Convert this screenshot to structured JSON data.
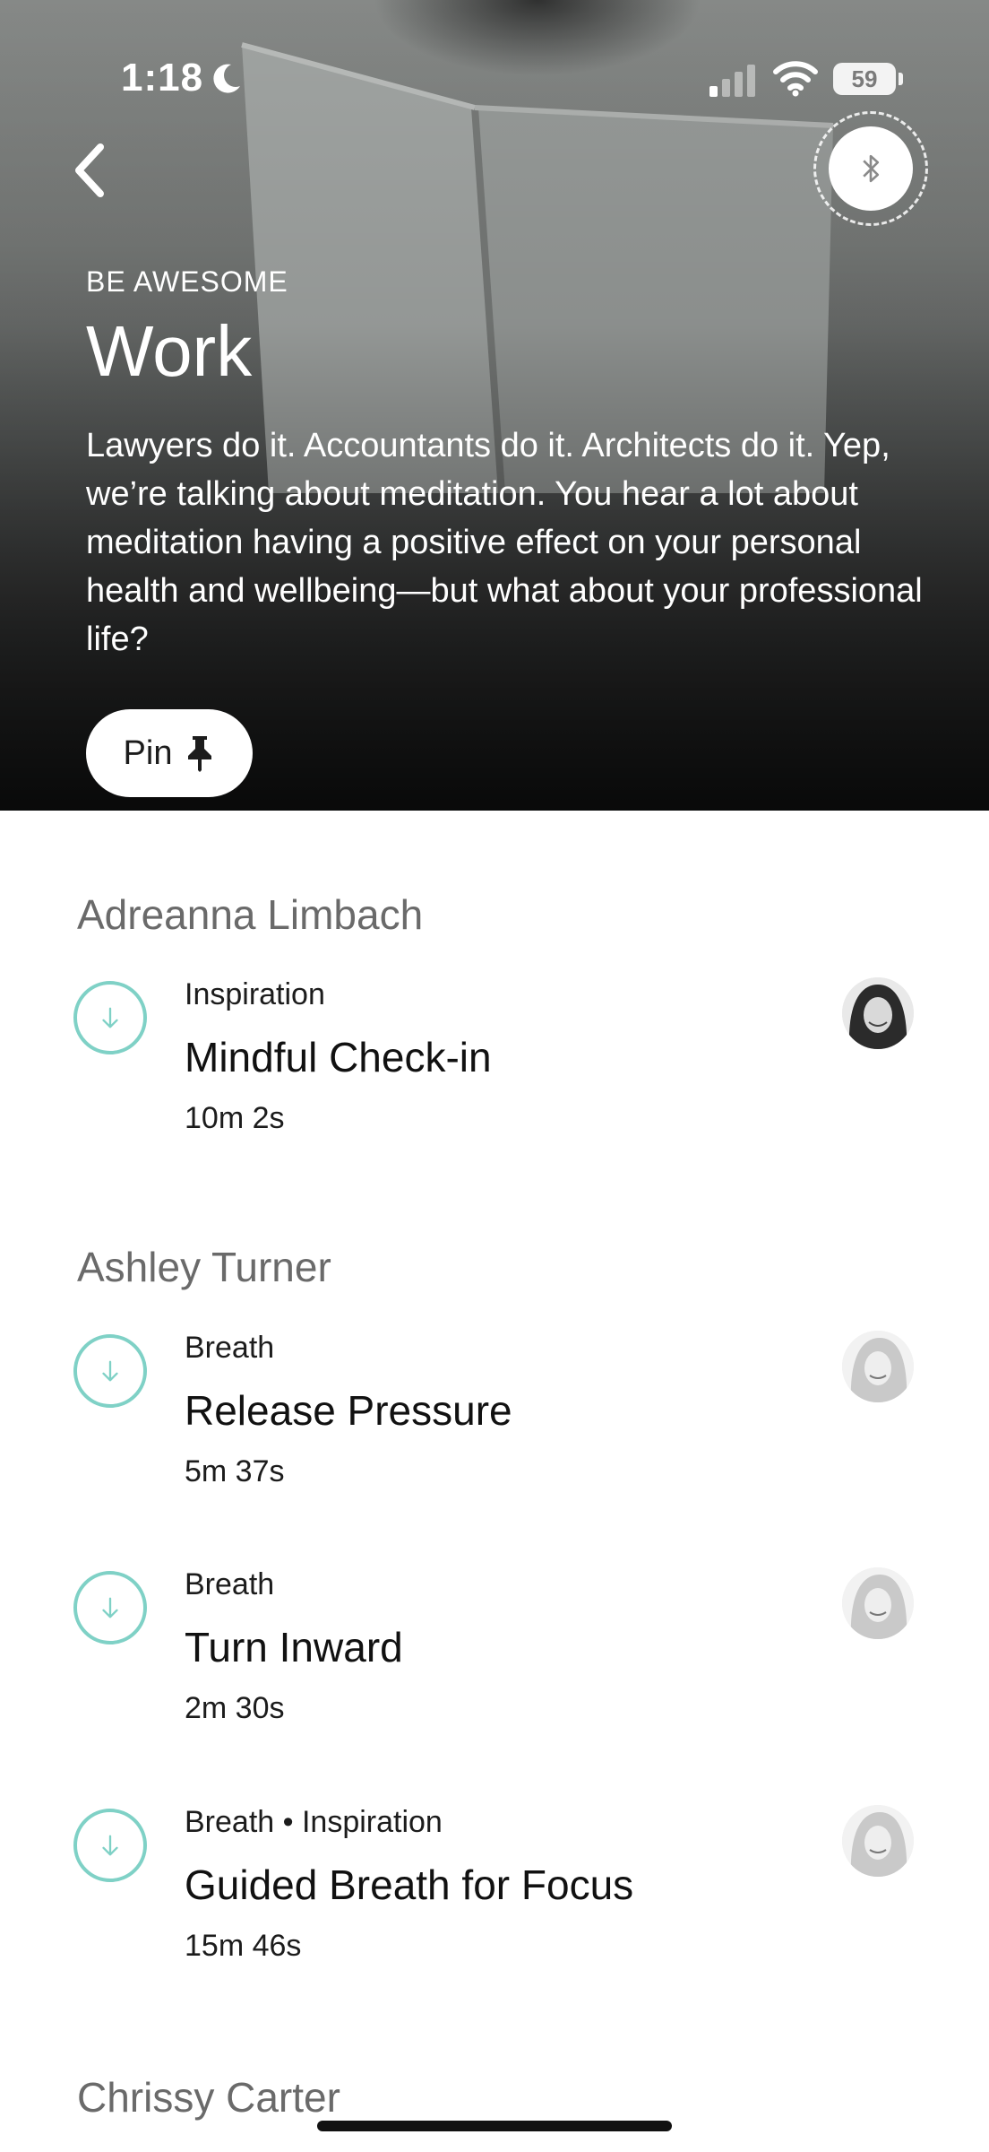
{
  "status_bar": {
    "time": "1:18",
    "battery": "59"
  },
  "hero": {
    "category": "BE AWESOME",
    "title": "Work",
    "description": "Lawyers do it. Accountants do it. Architects do it. Yep, we’re talking about meditation. You hear a lot about meditation having a positive effect on your personal health and wellbeing—but what about your professional life?",
    "pin_label": "Pin"
  },
  "groups": [
    {
      "teacher": "Adreanna Limbach",
      "items": [
        {
          "tag": "Inspiration",
          "title": "Mindful Check-in",
          "duration": "10m 2s"
        }
      ]
    },
    {
      "teacher": "Ashley Turner",
      "items": [
        {
          "tag": "Breath",
          "title": "Release Pressure",
          "duration": "5m 37s"
        },
        {
          "tag": "Breath",
          "title": "Turn Inward",
          "duration": "2m 30s"
        },
        {
          "tag": "Breath • Inspiration",
          "title": "Guided Breath for Focus",
          "duration": "15m 46s"
        }
      ]
    },
    {
      "teacher": "Chrissy Carter",
      "items": []
    }
  ],
  "colors": {
    "accent": "#7fd1c6",
    "teacher_heading": "#6a6a6a"
  },
  "icons": [
    "moon-icon",
    "signal-icon",
    "wifi-icon",
    "battery-icon",
    "back-chevron-icon",
    "bluetooth-icon",
    "pin-icon",
    "download-icon"
  ]
}
